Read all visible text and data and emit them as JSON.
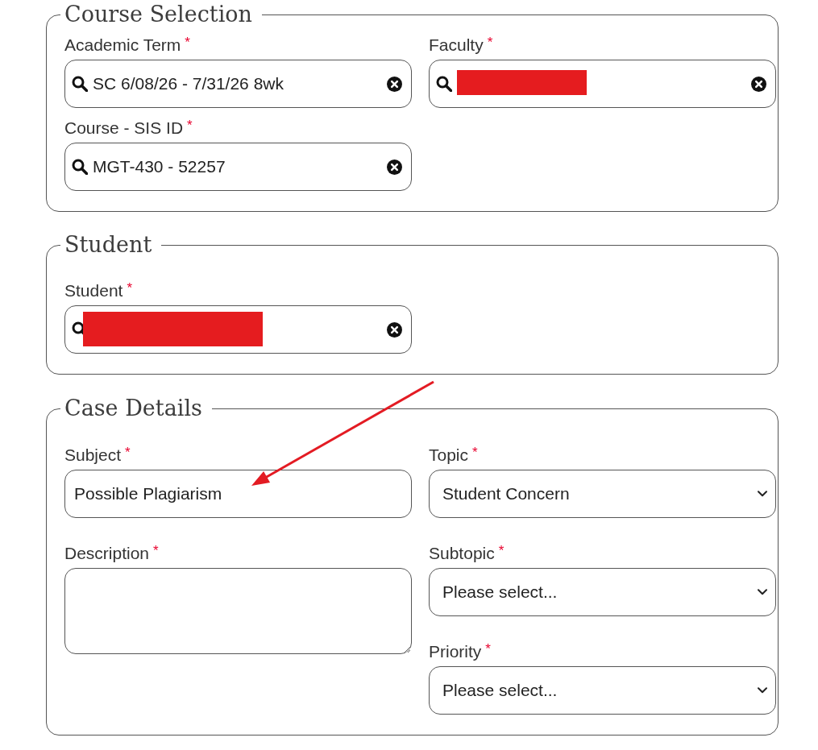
{
  "sections": [
    {
      "title": "Course Selection",
      "fields": [
        {
          "kind": "search",
          "label": "Academic Term",
          "required_mark": "*",
          "value": "SC 6/08/26 - 7/31/26 8wk",
          "redacted": false
        },
        {
          "kind": "search",
          "label": "Faculty",
          "required_mark": "*",
          "redacted": true
        },
        {
          "kind": "search",
          "label": "Course - SIS ID",
          "required_mark": "*",
          "value": "MGT-430 - 52257",
          "redacted": false
        }
      ]
    },
    {
      "title": "Student",
      "fields": [
        {
          "kind": "search",
          "label": "Student",
          "required_mark": "*",
          "redacted": true
        }
      ]
    },
    {
      "title": "Case Details",
      "fields": [
        {
          "kind": "text",
          "label": "Subject",
          "required_mark": "*",
          "value": "Possible Plagiarism",
          "redacted": false
        },
        {
          "kind": "select",
          "label": "Topic",
          "required_mark": "*",
          "value": "Student Concern",
          "redacted": false
        },
        {
          "kind": "textarea",
          "label": "Description",
          "required_mark": "*",
          "redacted": false
        },
        {
          "kind": "select",
          "label": "Subtopic",
          "required_mark": "*",
          "value": "Please select...",
          "redacted": false
        },
        {
          "kind": "select",
          "label": "Priority",
          "required_mark": "*",
          "value": "Please select...",
          "redacted": false
        }
      ]
    }
  ],
  "annotations": [
    {
      "kind": "arrow"
    }
  ]
}
